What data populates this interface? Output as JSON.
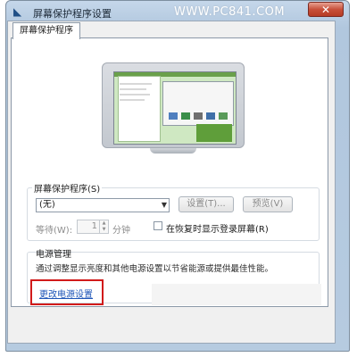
{
  "window": {
    "title": "屏幕保护程序设置"
  },
  "watermark": "WWW.PC841.COM",
  "tabs": [
    {
      "label": "屏幕保护程序"
    }
  ],
  "screensaver": {
    "group_label": "屏幕保护程序(S)",
    "selected": "(无)",
    "settings_button": "设置(T)...",
    "preview_button": "预览(V)",
    "wait_label": "等待(W):",
    "wait_value": "1",
    "minutes_label": "分钟",
    "resume_checkbox_label": "在恢复时显示登录屏幕(R)",
    "resume_checked": false
  },
  "power": {
    "title": "电源管理",
    "description": "通过调整显示亮度和其他电源设置以节省能源或提供最佳性能。",
    "link": "更改电源设置"
  },
  "colors": {
    "highlight_box": "#d11a1a",
    "link": "#1f56b8"
  },
  "icons": {
    "window_icon": "app-icon",
    "close": "close-icon"
  }
}
